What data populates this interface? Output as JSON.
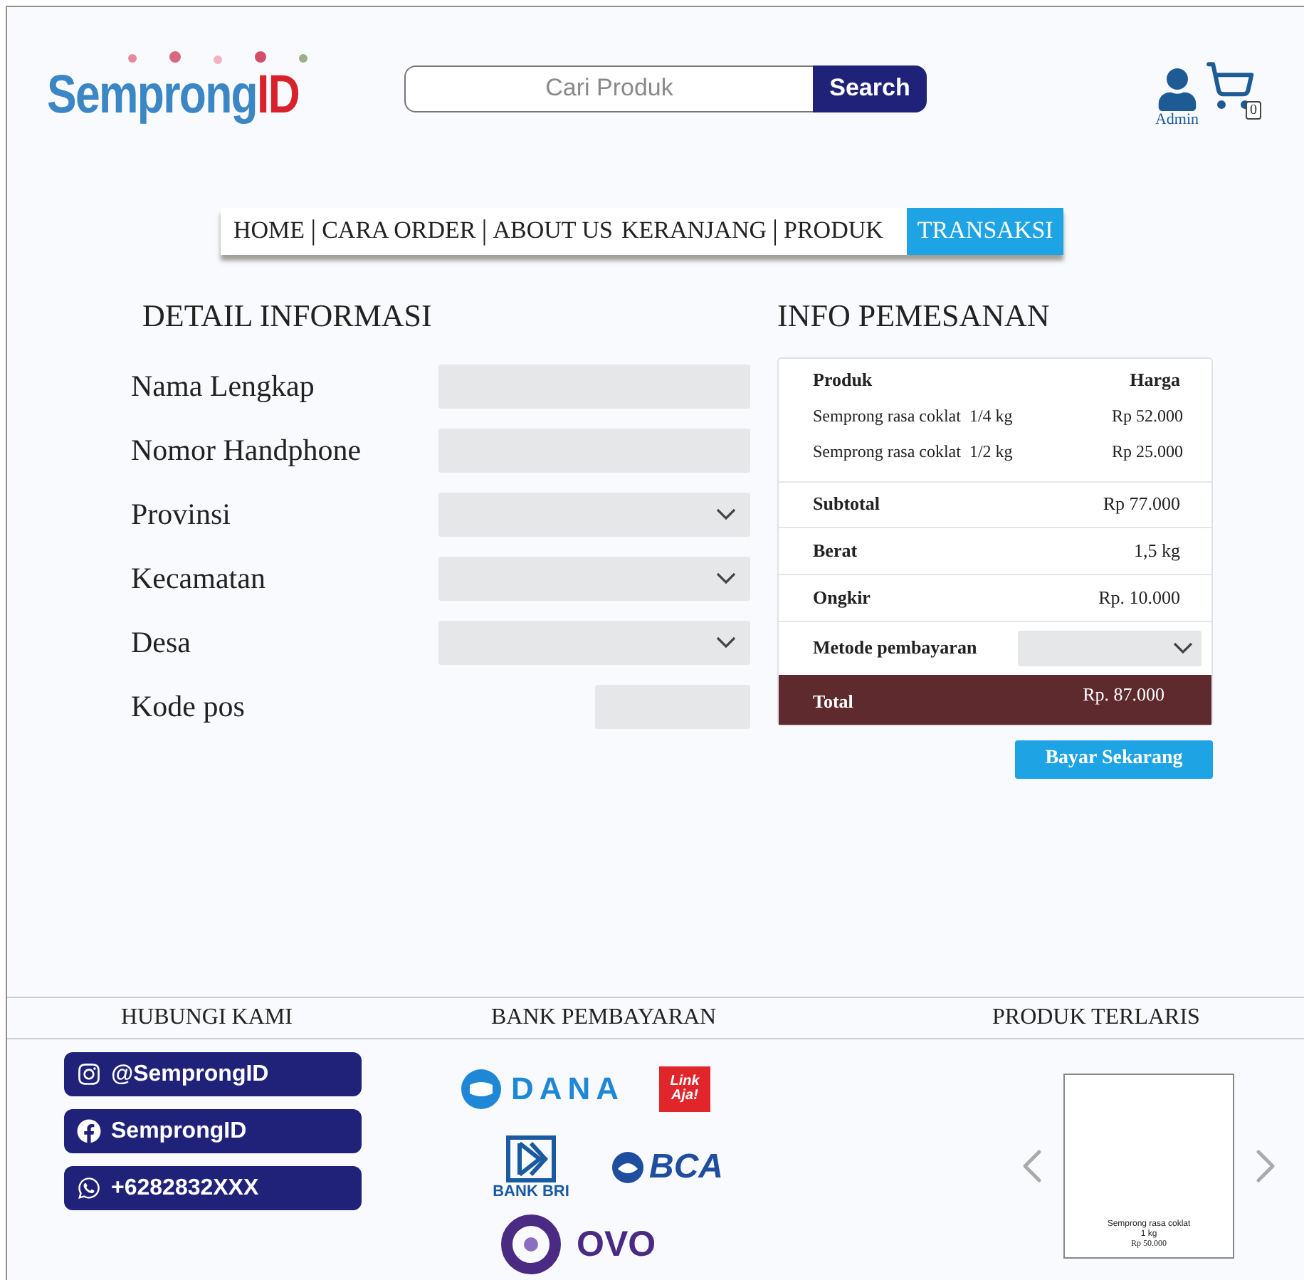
{
  "header": {
    "logo": {
      "text": "Semprong",
      "accent": "ID"
    },
    "search": {
      "placeholder": "Cari Produk",
      "button": "Search"
    },
    "user": {
      "label": "Admin"
    },
    "cart": {
      "count": "0"
    }
  },
  "nav": [
    {
      "kind": "link",
      "label": "HOME",
      "selected": false
    },
    {
      "kind": "divider",
      "label": "|"
    },
    {
      "kind": "link",
      "label": "CARA ORDER",
      "selected": false
    },
    {
      "kind": "divider",
      "label": "|"
    },
    {
      "kind": "link",
      "label": "ABOUT US",
      "selected": false
    },
    {
      "kind": "link",
      "label": "KERANJANG",
      "selected": false
    },
    {
      "kind": "divider",
      "label": "|"
    },
    {
      "kind": "link",
      "label": "PRODUK",
      "selected": false
    },
    {
      "kind": "link",
      "label": "TRANSAKSI",
      "selected": true
    }
  ],
  "detail": {
    "title": "DETAIL INFORMASI",
    "fields": [
      {
        "label": "Nama Lengkap",
        "kind": "text"
      },
      {
        "label": "Nomor Handphone",
        "kind": "text"
      },
      {
        "label": "Provinsi",
        "kind": "select"
      },
      {
        "label": "Kecamatan",
        "kind": "select"
      },
      {
        "label": "Desa",
        "kind": "select"
      },
      {
        "label": "Kode pos",
        "kind": "short"
      }
    ]
  },
  "order": {
    "title": "INFO PEMESANAN",
    "columns": [
      "Produk",
      "Harga"
    ],
    "items": [
      {
        "name": "Semprong rasa coklat  1/4 kg",
        "price": "Rp 52.000"
      },
      {
        "name": "Semprong rasa coklat  1/2 kg",
        "price": "Rp 25.000"
      }
    ],
    "summary": [
      {
        "label": "Subtotal",
        "value": "Rp 77.000"
      },
      {
        "label": "Berat",
        "value": "1,5 kg"
      },
      {
        "label": "Ongkir",
        "value": "Rp. 10.000"
      }
    ],
    "payment": {
      "label": "Metode pembayaran"
    },
    "total": {
      "label": "Total",
      "value": "Rp. 87.000"
    },
    "button": "Bayar Sekarang"
  },
  "footer": {
    "contact": {
      "title": "HUBUNGI KAMI",
      "items": [
        {
          "kind": "instagram",
          "text": "@SemprongID"
        },
        {
          "kind": "facebook",
          "text": "SemprongID"
        },
        {
          "kind": "whatsapp",
          "text": "+6282832XXX"
        }
      ]
    },
    "banks": {
      "title": "BANK PEMBAYARAN",
      "items": [
        {
          "kind": "dana",
          "name": "DANA"
        },
        {
          "kind": "linkaja",
          "name": "Link Aja!"
        },
        {
          "kind": "bri",
          "name": "BANK BRI"
        },
        {
          "kind": "bca",
          "name": "BCA"
        },
        {
          "kind": "ovo",
          "name": "OVO"
        }
      ]
    },
    "bestseller": {
      "title": "PRODUK TERLARIS",
      "product": {
        "name": "Semprong rasa coklat",
        "weight": "1 kg",
        "price": "Rp 50.000"
      }
    }
  }
}
